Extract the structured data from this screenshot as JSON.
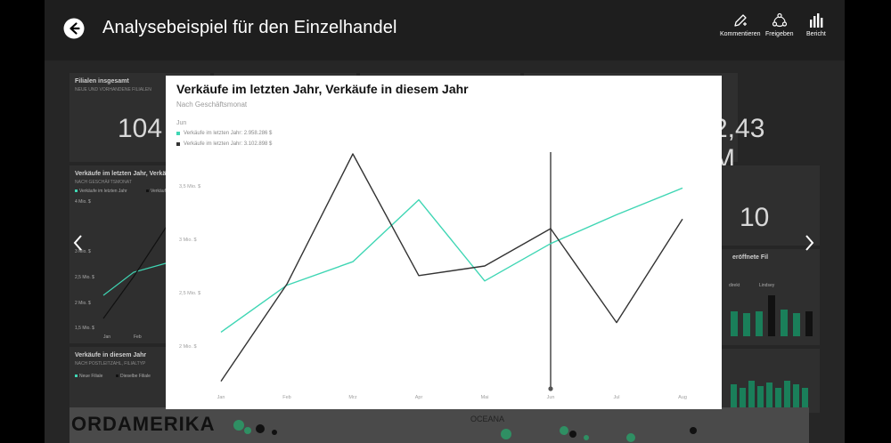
{
  "header": {
    "title": "Analysebeispiel für den Einzelhandel",
    "tools": [
      {
        "label": "Kommentieren",
        "icon": "comment-icon"
      },
      {
        "label": "Freigeben",
        "icon": "share-icon"
      },
      {
        "label": "Bericht",
        "icon": "report-icon"
      }
    ]
  },
  "dashboard": {
    "tile1_title": "Filialen insgesamt",
    "tile1_sub": "NEUE UND VORHANDENE FILIALEN",
    "tile1_value": "104",
    "tile2_value": "2,43 M",
    "tile3_title": "Verkäufe im letzten Jahr, Verkäufe in diesem Jahr",
    "tile3_sub": "NACH GESCHÄFTSMONAT",
    "tile3_leg1": "Verkäufe im letzten Jahr",
    "tile3_leg2": "Verkäufe in diesem Jahr",
    "tile3_y": [
      "4 Mio. $",
      "3 Mio. $",
      "2,5 Mio. $",
      "2 Mio. $",
      "1,5 Mio. $"
    ],
    "tile3_x": [
      "Jan",
      "Feb"
    ],
    "tile4_value": "10",
    "tile5_title": "eröffnete Fil",
    "tile5_leg1": "direkt",
    "tile5_leg2": "Lindsey",
    "tile6_title": "Verkäufe in diesem Jahr",
    "tile6_sub": "NACH POSTLEITZAHL, FILIALTYP",
    "tile6_leg1": "Neue Filiale",
    "tile6_leg2": "Dieselbe Filiale",
    "map_label": "ORDAMERIKA",
    "map_label2": "OCEANA"
  },
  "modal": {
    "title": "Verkäufe im letzten Jahr, Verkäufe in diesem Jahr",
    "subtitle": "Nach Geschäftsmonat",
    "tooltip_month": "Jun",
    "legend": [
      {
        "label": "Verkäufe im letzten Jahr: 2.958.286 $",
        "color": "#3fd6b4"
      },
      {
        "label": "Verkäufe im letzten Jahr: 3.102.898 $",
        "color": "#333333"
      }
    ]
  },
  "chart_data": {
    "type": "line",
    "title": "Verkäufe im letzten Jahr, Verkäufe in diesem Jahr",
    "subtitle": "Nach Geschäftsmonat",
    "categories": [
      "Jan",
      "Feb",
      "Mrz",
      "Apr",
      "Mai",
      "Jun",
      "Jul",
      "Aug"
    ],
    "y_ticks": [
      "2 Mio. $",
      "2,5 Mio. $",
      "3 Mio. $",
      "3,5 Mio. $"
    ],
    "y_tick_values": [
      2.0,
      2.5,
      3.0,
      3.5
    ],
    "series": [
      {
        "name": "Verkäufe im letzten Jahr",
        "color": "#3fd6b4",
        "values": [
          2.13,
          2.57,
          2.79,
          3.37,
          2.61,
          2.96,
          3.23,
          3.48
        ]
      },
      {
        "name": "Verkäufe in diesem Jahr",
        "color": "#333333",
        "values": [
          1.67,
          2.58,
          3.8,
          2.66,
          2.75,
          3.1,
          2.22,
          3.19
        ]
      }
    ],
    "highlight_category": "Jun",
    "grid": false
  },
  "colors": {
    "accent_teal": "#3fd6b4",
    "dark_series": "#333333",
    "appbar": "#1e1e1e",
    "dashboard_bg": "#262626"
  }
}
